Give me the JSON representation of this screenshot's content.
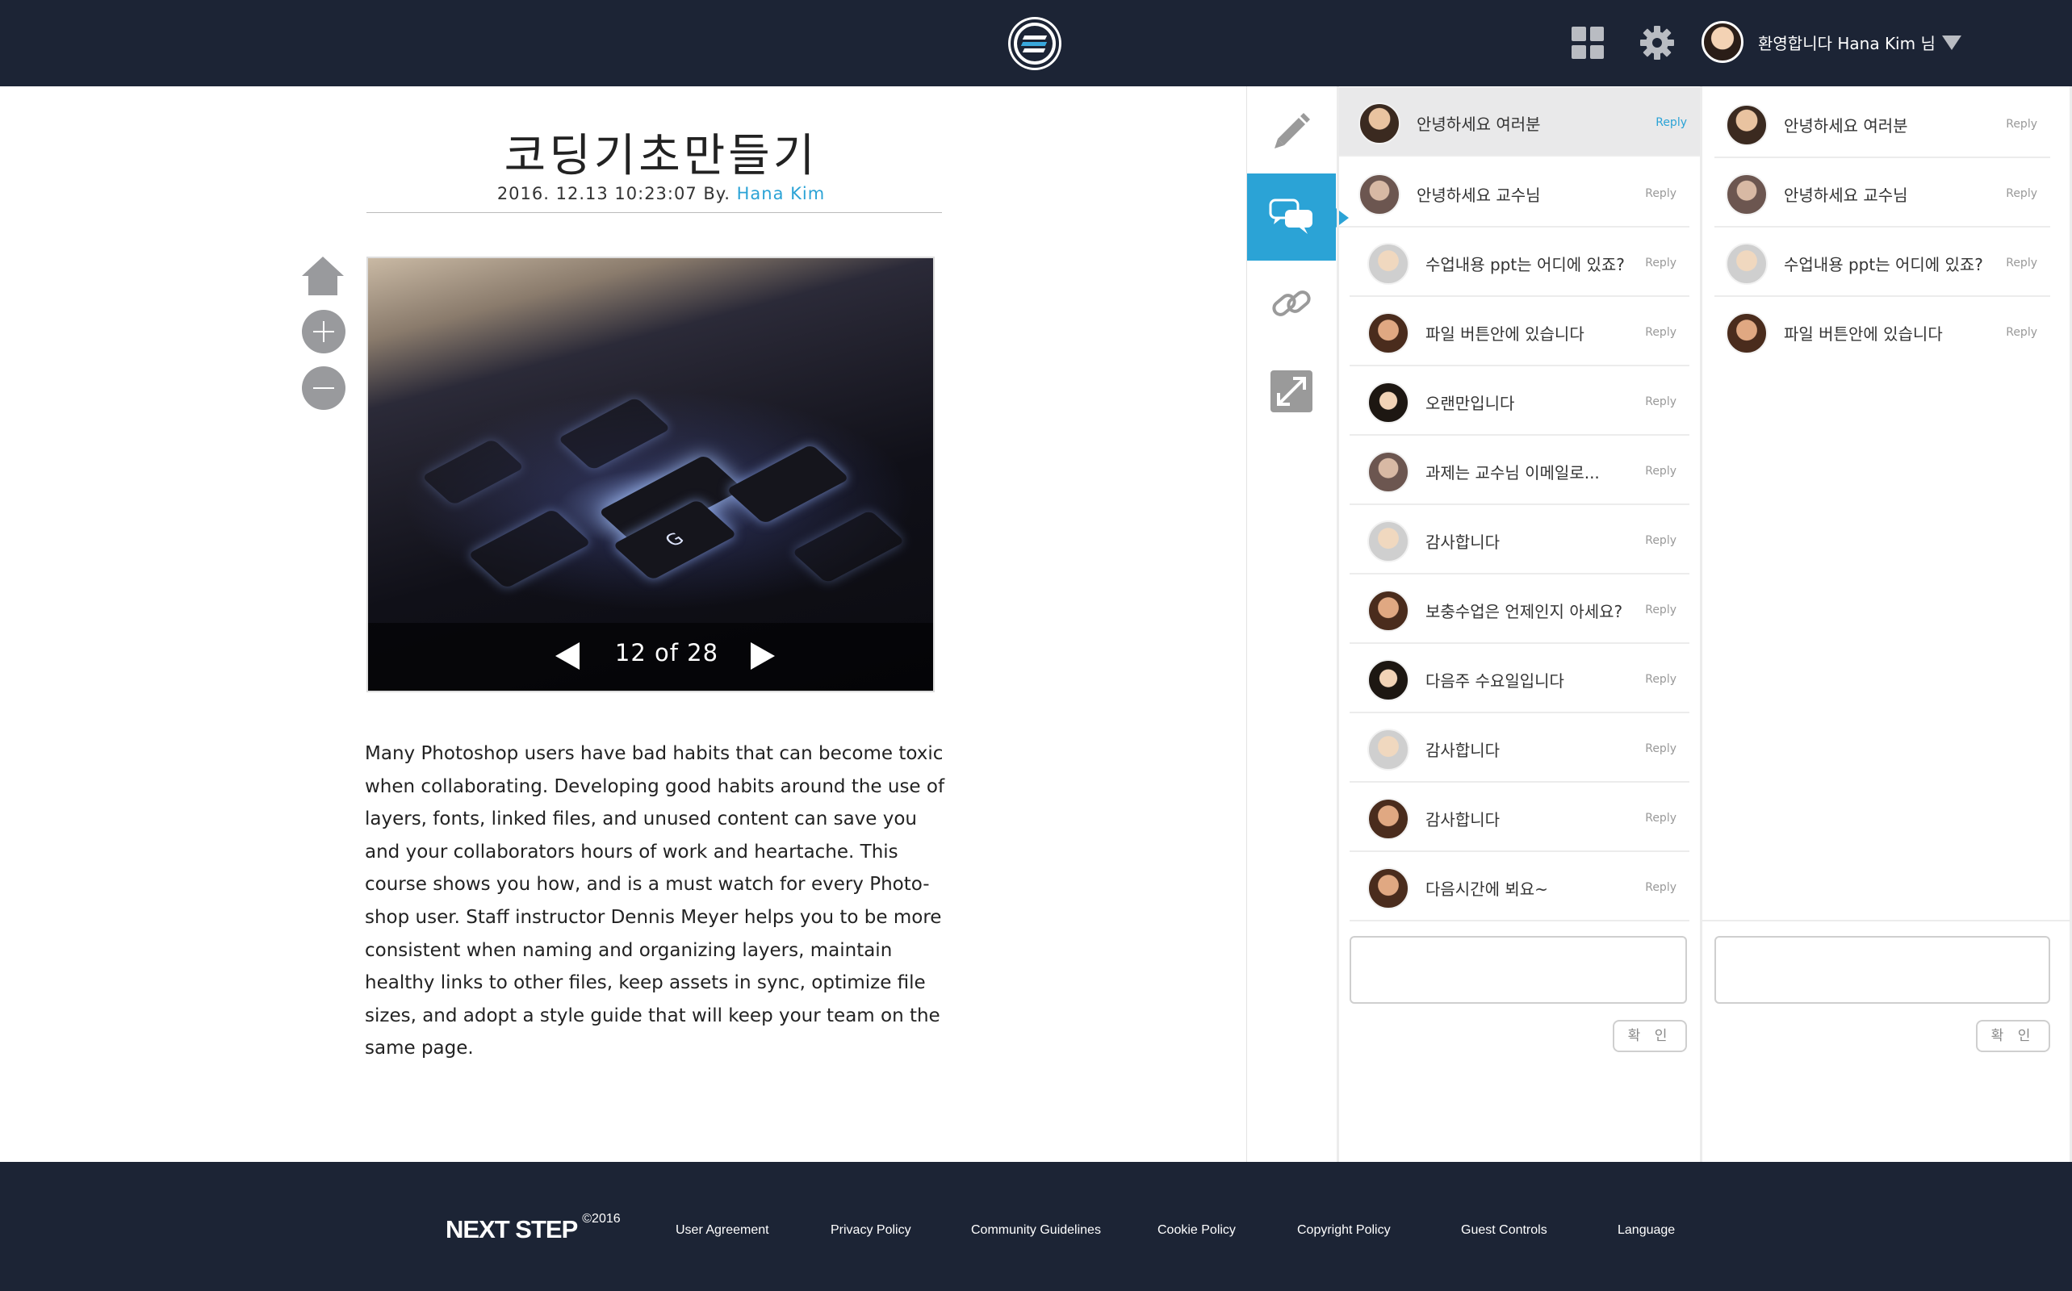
{
  "header": {
    "welcome_text": "환영합니다 Hana Kim 님"
  },
  "article": {
    "title": "코딩기초만들기",
    "date": "2016. 12.13  10:23:07 By. ",
    "author": "Hana Kim",
    "slide_counter": "12 of 28",
    "slide_key_letter": "G",
    "body": "Many Photoshop users have bad habits that can become toxic when collaborating. Developing good habits around the use of layers, fonts, linked files, and unused content can save you and your collaborators hours of work and heartache. This course shows you how, and is a must watch for every Photo-shop user. Staff instructor Dennis Meyer helps you to be more consistent when naming and organizing layers, maintain healthy links to other files, keep assets in sync, optimize file sizes, and adopt a style guide that will keep your team on the same page."
  },
  "comments_main": [
    {
      "text": "안녕하세요 여러분",
      "reply": "Reply"
    },
    {
      "text": "안녕하세요 교수님",
      "reply": "Reply"
    },
    {
      "text": "수업내용 ppt는 어디에 있죠?",
      "reply": "Reply"
    },
    {
      "text": "파일 버튼안에 있습니다",
      "reply": "Reply"
    },
    {
      "text": "오랜만입니다",
      "reply": "Reply"
    },
    {
      "text": "과제는 교수님 이메일로...",
      "reply": "Reply"
    },
    {
      "text": "감사합니다",
      "reply": "Reply"
    },
    {
      "text": "보충수업은 언제인지 아세요?",
      "reply": "Reply"
    },
    {
      "text": "다음주 수요일입니다",
      "reply": "Reply"
    },
    {
      "text": "감사합니다",
      "reply": "Reply"
    },
    {
      "text": "감사합니다",
      "reply": "Reply"
    },
    {
      "text": "다음시간에 뵈요~",
      "reply": "Reply"
    }
  ],
  "comments_thread": [
    {
      "text": "안녕하세요 여러분",
      "reply": "Reply"
    },
    {
      "text": "안녕하세요 교수님",
      "reply": "Reply"
    },
    {
      "text": "수업내용 ppt는 어디에 있죠?",
      "reply": "Reply"
    },
    {
      "text": "파일 버튼안에 있습니다",
      "reply": "Reply"
    }
  ],
  "confirm_label": "확 인",
  "footer": {
    "brand": "NEXT STEP",
    "year": "©2016",
    "links": [
      "User Agreement",
      "Privacy Policy",
      "Community Guidelines",
      "Cookie Policy",
      "Copyright Policy",
      "Guest Controls",
      "Language"
    ]
  },
  "colors": {
    "navy": "#1c2435",
    "accent": "#2ba3d6"
  }
}
